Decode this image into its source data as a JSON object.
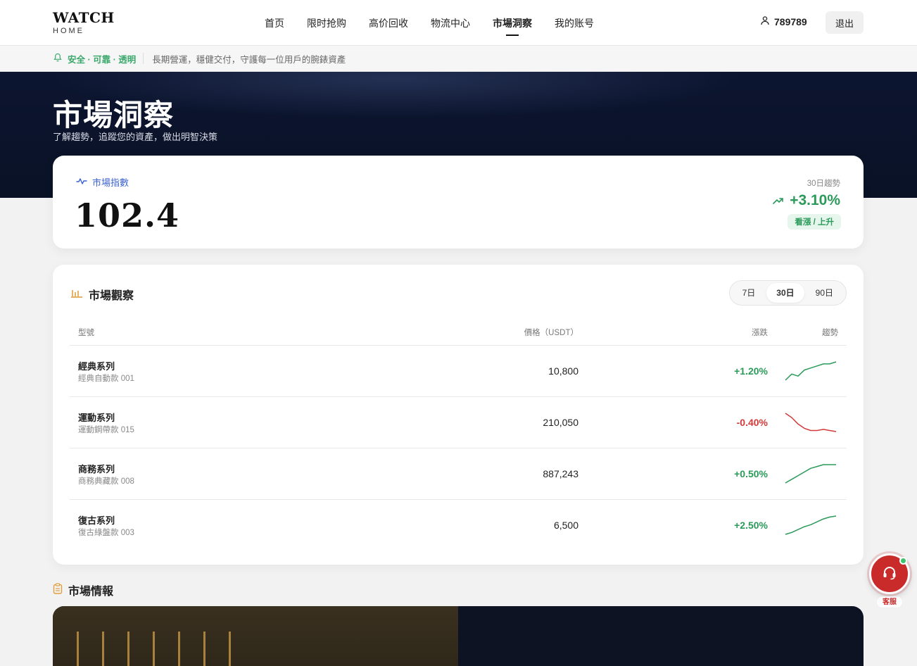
{
  "header": {
    "logo": "WATCH",
    "logo_sub": "HOME",
    "nav": [
      "首页",
      "限时抢购",
      "高价回收",
      "物流中心",
      "市場洞察",
      "我的账号"
    ],
    "active_nav": "市場洞察",
    "user_id": "789789",
    "logout_label": "退出"
  },
  "notice": {
    "tag": "安全 · 可靠 · 透明",
    "text": "長期營運，穩健交付，守護每一位用戶的腕錶資產"
  },
  "hero": {
    "title": "市場洞察",
    "subtitle": "了解趨勢，追蹤您的資產，做出明智決策"
  },
  "index_card": {
    "label": "市場指數",
    "value": "102.4",
    "trend_label": "30日趨勢",
    "trend_value": "+3.10%",
    "trend_badge": "看漲 / 上升"
  },
  "market_watch": {
    "title": "市場觀察",
    "ranges": [
      "7日",
      "30日",
      "90日"
    ],
    "active_range": "30日",
    "columns": {
      "model": "型號",
      "price": "價格（USDT）",
      "change": "漲跌",
      "trend": "趨勢"
    },
    "rows": [
      {
        "name": "經典系列",
        "sub": "經典自動款 001",
        "price": "10,800",
        "change": "+1.20%",
        "direction": "up",
        "spark": [
          2,
          5,
          4,
          7,
          8,
          9,
          10,
          10,
          11
        ]
      },
      {
        "name": "運動系列",
        "sub": "運動鋼帶款 015",
        "price": "210,050",
        "change": "-0.40%",
        "direction": "down",
        "spark": [
          11,
          9,
          6,
          4,
          3,
          3,
          3.5,
          3,
          2.5
        ]
      },
      {
        "name": "商務系列",
        "sub": "商務典藏款 008",
        "price": "887,243",
        "change": "+0.50%",
        "direction": "up",
        "spark": [
          1,
          3,
          5,
          7,
          9,
          10,
          11,
          11,
          11
        ]
      },
      {
        "name": "復古系列",
        "sub": "復古綠盤款 003",
        "price": "6,500",
        "change": "+2.50%",
        "direction": "up",
        "spark": [
          1,
          2,
          3.5,
          5,
          6,
          7.5,
          9,
          10,
          10.5
        ]
      }
    ]
  },
  "intel": {
    "title": "市場情報"
  },
  "support": {
    "label": "客服"
  },
  "colors": {
    "up": "#2b9a5a",
    "down": "#d23b3b",
    "accent_orange": "#e0a040"
  }
}
